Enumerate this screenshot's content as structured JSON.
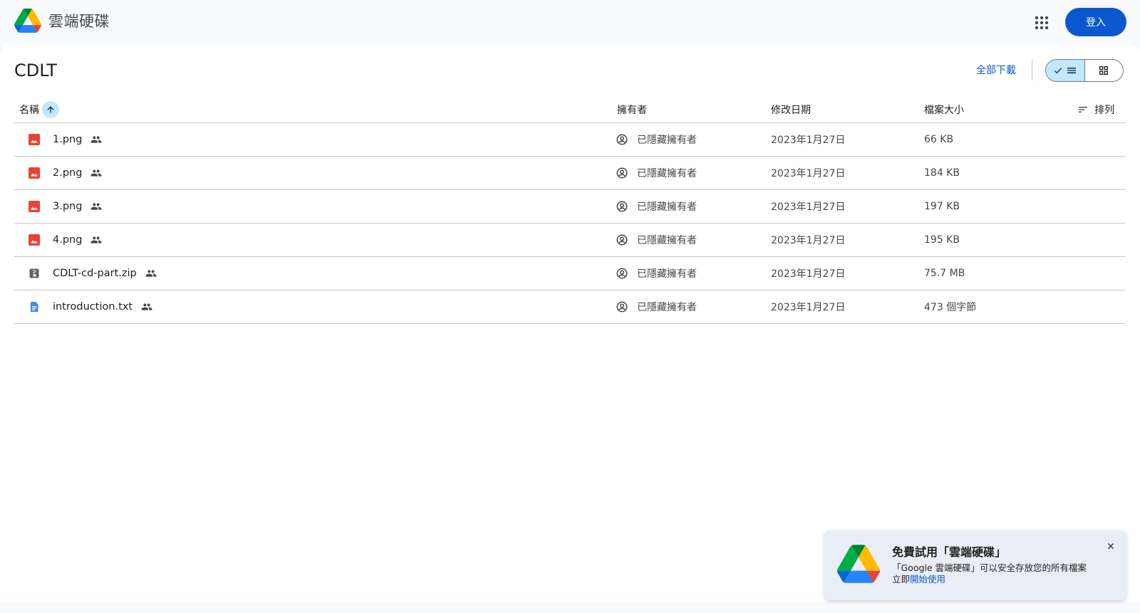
{
  "header": {
    "app_title": "雲端硬碟",
    "sign_in_label": "登入"
  },
  "toolbar": {
    "folder_title": "CDLT",
    "download_all_label": "全部下載",
    "view_mode": "list"
  },
  "table": {
    "columns": {
      "name": "名稱",
      "owner": "擁有者",
      "modified": "修改日期",
      "size": "檔案大小",
      "sort": "排列"
    },
    "rows": [
      {
        "name": "1.png",
        "type": "image",
        "owner": "已隱藏擁有者",
        "modified": "2023年1月27日",
        "size": "66 KB"
      },
      {
        "name": "2.png",
        "type": "image",
        "owner": "已隱藏擁有者",
        "modified": "2023年1月27日",
        "size": "184 KB"
      },
      {
        "name": "3.png",
        "type": "image",
        "owner": "已隱藏擁有者",
        "modified": "2023年1月27日",
        "size": "197 KB"
      },
      {
        "name": "4.png",
        "type": "image",
        "owner": "已隱藏擁有者",
        "modified": "2023年1月27日",
        "size": "195 KB"
      },
      {
        "name": "CDLT-cd-part.zip",
        "type": "zip",
        "owner": "已隱藏擁有者",
        "modified": "2023年1月27日",
        "size": "75.7 MB"
      },
      {
        "name": "introduction.txt",
        "type": "doc",
        "owner": "已隱藏擁有者",
        "modified": "2023年1月27日",
        "size": "473 個字節"
      }
    ]
  },
  "toast": {
    "title": "免費試用「雲端硬碟」",
    "body": "「Google 雲端硬碟」可以安全存放您的所有檔案",
    "prefix": "立即",
    "link": "開始使用"
  },
  "colors": {
    "accent": "#0b57d0",
    "image_icon": "#ea4335",
    "doc_icon": "#4285f4",
    "zip_icon": "#5f6368"
  }
}
